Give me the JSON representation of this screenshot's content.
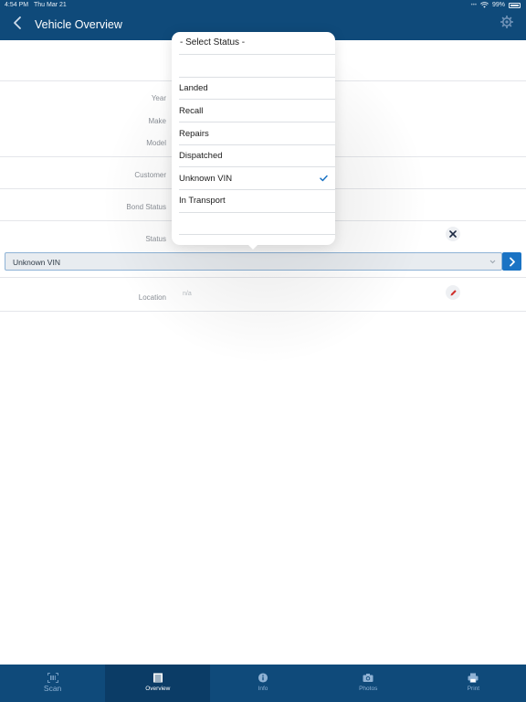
{
  "status_bar": {
    "time": "4:54 PM",
    "date": "Thu Mar 21",
    "battery": "99%"
  },
  "header": {
    "title": "Vehicle Overview",
    "back_icon": "chevron-left-icon",
    "settings_icon": "gear-icon"
  },
  "fields": {
    "year_label": "Year",
    "make_label": "Make",
    "model_label": "Model",
    "customer_label": "Customer",
    "bond_status_label": "Bond Status",
    "status_label": "Status",
    "location_label": "Location",
    "location_value": "n/a"
  },
  "status_select": {
    "selected": "Unknown VIN"
  },
  "dropdown": {
    "header": "- Select Status -",
    "options": [
      {
        "label": "",
        "checked": false
      },
      {
        "label": "Landed",
        "checked": false
      },
      {
        "label": "Recall",
        "checked": false
      },
      {
        "label": "Repairs",
        "checked": false
      },
      {
        "label": "Dispatched",
        "checked": false
      },
      {
        "label": "Unknown VIN",
        "checked": true
      },
      {
        "label": "In Transport",
        "checked": false
      },
      {
        "label": "",
        "checked": false
      }
    ]
  },
  "tabs": [
    {
      "label": "Scan",
      "icon": "barcode-icon",
      "active": false
    },
    {
      "label": "Overview",
      "icon": "list-icon",
      "active": true
    },
    {
      "label": "Info",
      "icon": "info-icon",
      "active": false
    },
    {
      "label": "Photos",
      "icon": "camera-icon",
      "active": false
    },
    {
      "label": "Print",
      "icon": "printer-icon",
      "active": false
    }
  ],
  "colors": {
    "header_bg": "#0f4a7a",
    "accent": "#1a73c4",
    "active_tab_bg": "#0b3c66",
    "edit_icon": "#d0312d"
  }
}
